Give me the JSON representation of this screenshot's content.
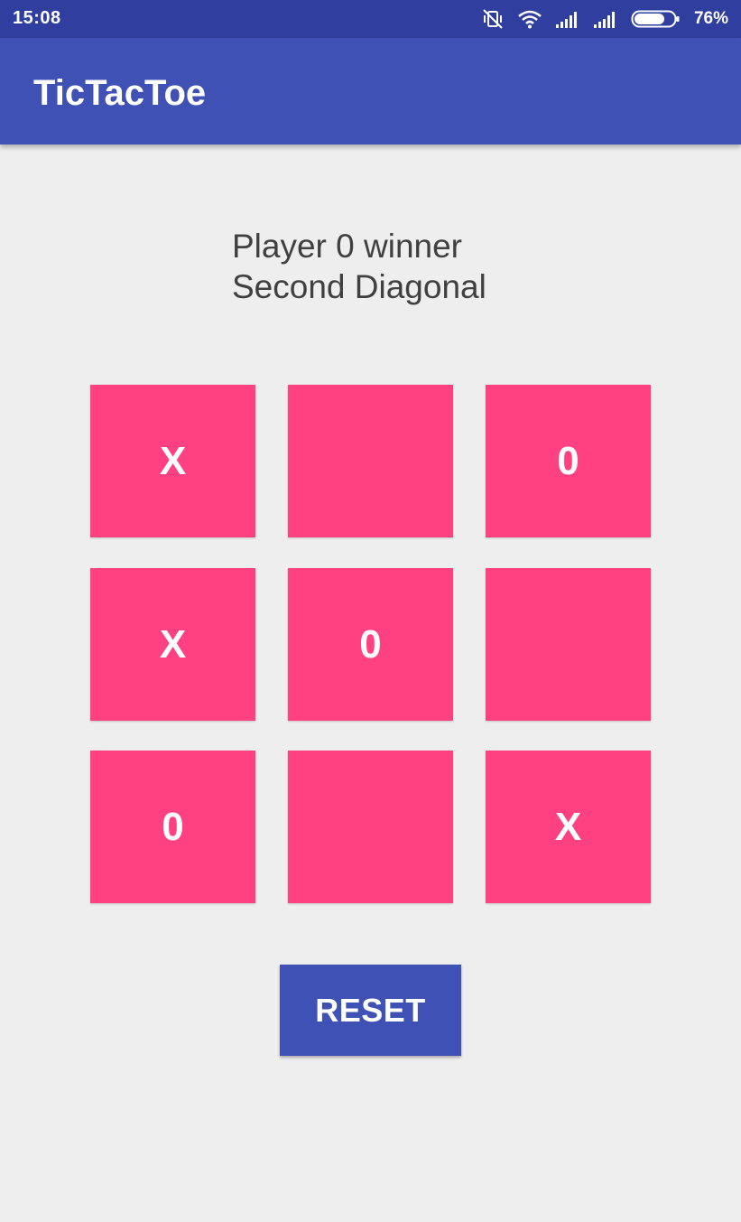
{
  "status_bar": {
    "time": "15:08",
    "battery_percent": "76%",
    "battery_level": 0.76,
    "icons": [
      "vibrate-off-icon",
      "wifi-icon",
      "signal-icon",
      "signal-icon",
      "battery-icon"
    ]
  },
  "app_bar": {
    "title": "TicTacToe"
  },
  "message": {
    "line1": "Player 0 winner",
    "line2": "Second Diagonal"
  },
  "board": {
    "cells": [
      "X",
      "",
      "0",
      "X",
      "0",
      "",
      "0",
      "",
      "X"
    ]
  },
  "reset": {
    "label": "RESET"
  },
  "colors": {
    "status_bar": "#303f9f",
    "app_bar": "#3f51b5",
    "cell": "#ff4081",
    "background": "#eeeeee",
    "message_text": "#404040"
  }
}
